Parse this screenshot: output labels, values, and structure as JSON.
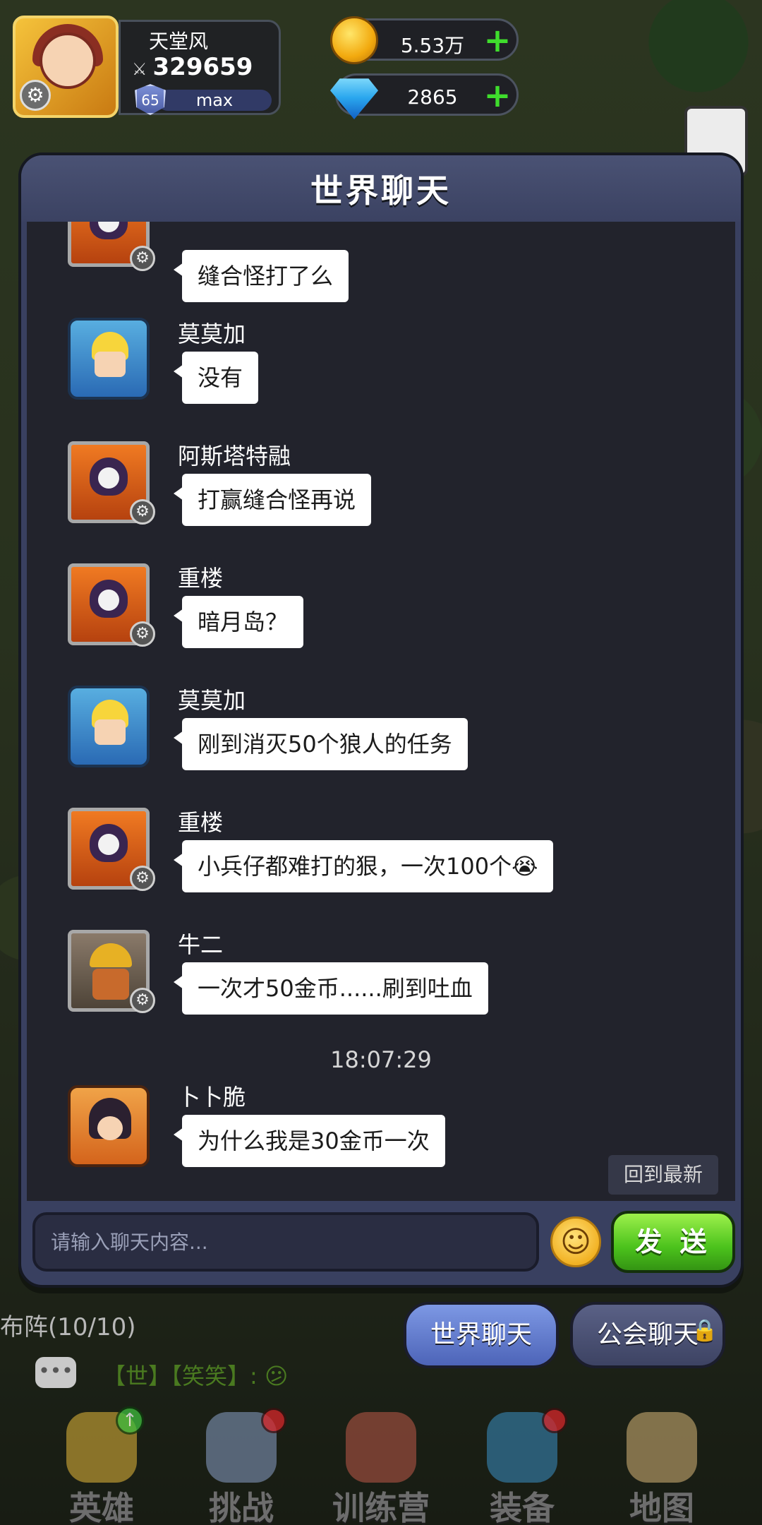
{
  "player": {
    "name": "天堂风",
    "power": "329659",
    "level": "65",
    "exp_label": "max"
  },
  "currencies": {
    "gold": "5.53万",
    "diamond": "2865"
  },
  "chat": {
    "title": "世界聊天",
    "messages": [
      {
        "sender": "",
        "text": "缝合怪打了么",
        "avatar": "skull-hood-icon"
      },
      {
        "sender": "莫莫加",
        "text": "没有",
        "avatar": "blond-hero-icon"
      },
      {
        "sender": "阿斯塔特融",
        "text": "打赢缝合怪再说",
        "avatar": "skull-hood-icon"
      },
      {
        "sender": "重楼",
        "text": "暗月岛？",
        "avatar": "skull-hood-icon"
      },
      {
        "sender": "莫莫加",
        "text": "刚到消灭50个狼人的任务",
        "avatar": "blond-hero-icon"
      },
      {
        "sender": "重楼",
        "text": "小兵仔都难打的狠，一次100个😭",
        "avatar": "skull-hood-icon"
      },
      {
        "sender": "牛二",
        "text": "一次才50金币......刷到吐血",
        "avatar": "miner-icon"
      },
      {
        "sender": "卜卜脆",
        "text": "为什么我是30金币一次",
        "avatar": "lady-icon"
      }
    ],
    "timestamp": "18:07:29",
    "back_to_latest": "回到最新",
    "input_placeholder": "请输入聊天内容...",
    "send_label": "发 送"
  },
  "formation": "布阵(10/10)",
  "tabs": {
    "world": "世界聊天",
    "guild": "公会聊天"
  },
  "ticker": {
    "text": "【世】【笑笑】: 😕"
  },
  "nav": [
    {
      "label": "英雄"
    },
    {
      "label": "挑战"
    },
    {
      "label": "训练营"
    },
    {
      "label": "装备"
    },
    {
      "label": "地图"
    }
  ],
  "colors": {
    "panel": "#394060",
    "chat_bg": "#22232c",
    "send_green": "#4bc21c",
    "tab_active": "#5d78cc"
  }
}
